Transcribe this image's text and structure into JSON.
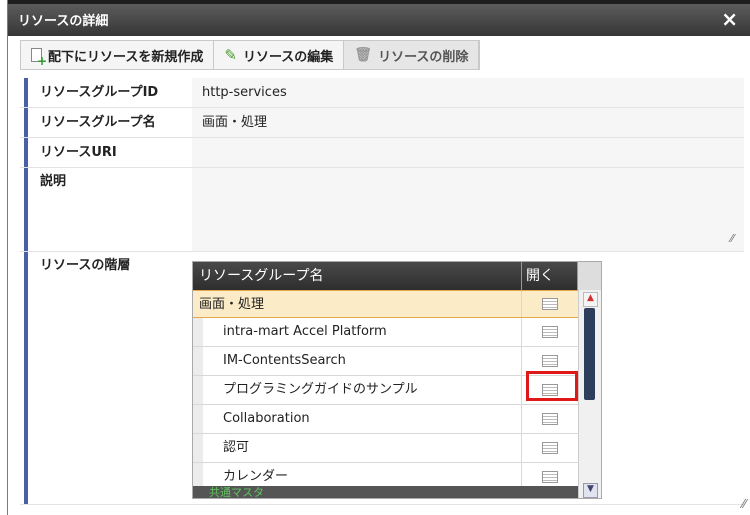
{
  "dialog": {
    "title": "リソースの詳細",
    "close_glyph": "×"
  },
  "toolbar": {
    "create_child_label": "配下にリソースを新規作成",
    "edit_label": "リソースの編集",
    "delete_label": "リソースの削除"
  },
  "form": {
    "group_id_label": "リソースグループID",
    "group_id_value": "http-services",
    "group_name_label": "リソースグループ名",
    "group_name_value": "画面・処理",
    "uri_label": "リソースURI",
    "uri_value": "",
    "description_label": "説明",
    "description_value": "",
    "hierarchy_label": "リソースの階層"
  },
  "grid": {
    "columns": [
      "リソースグループ名",
      "開く"
    ],
    "rows": [
      {
        "name": "画面・処理"
      },
      {
        "name": "intra-mart Accel Platform"
      },
      {
        "name": "IM-ContentsSearch"
      },
      {
        "name": "プログラミングガイドのサンプル"
      },
      {
        "name": "Collaboration"
      },
      {
        "name": "認可"
      },
      {
        "name": "カレンダー"
      }
    ],
    "partial_bottom_row": "共通マスタ"
  },
  "colors": {
    "accent_bar": "#4b5fa8",
    "selected_row": "#fcebc7",
    "highlight_box": "#e01818"
  }
}
